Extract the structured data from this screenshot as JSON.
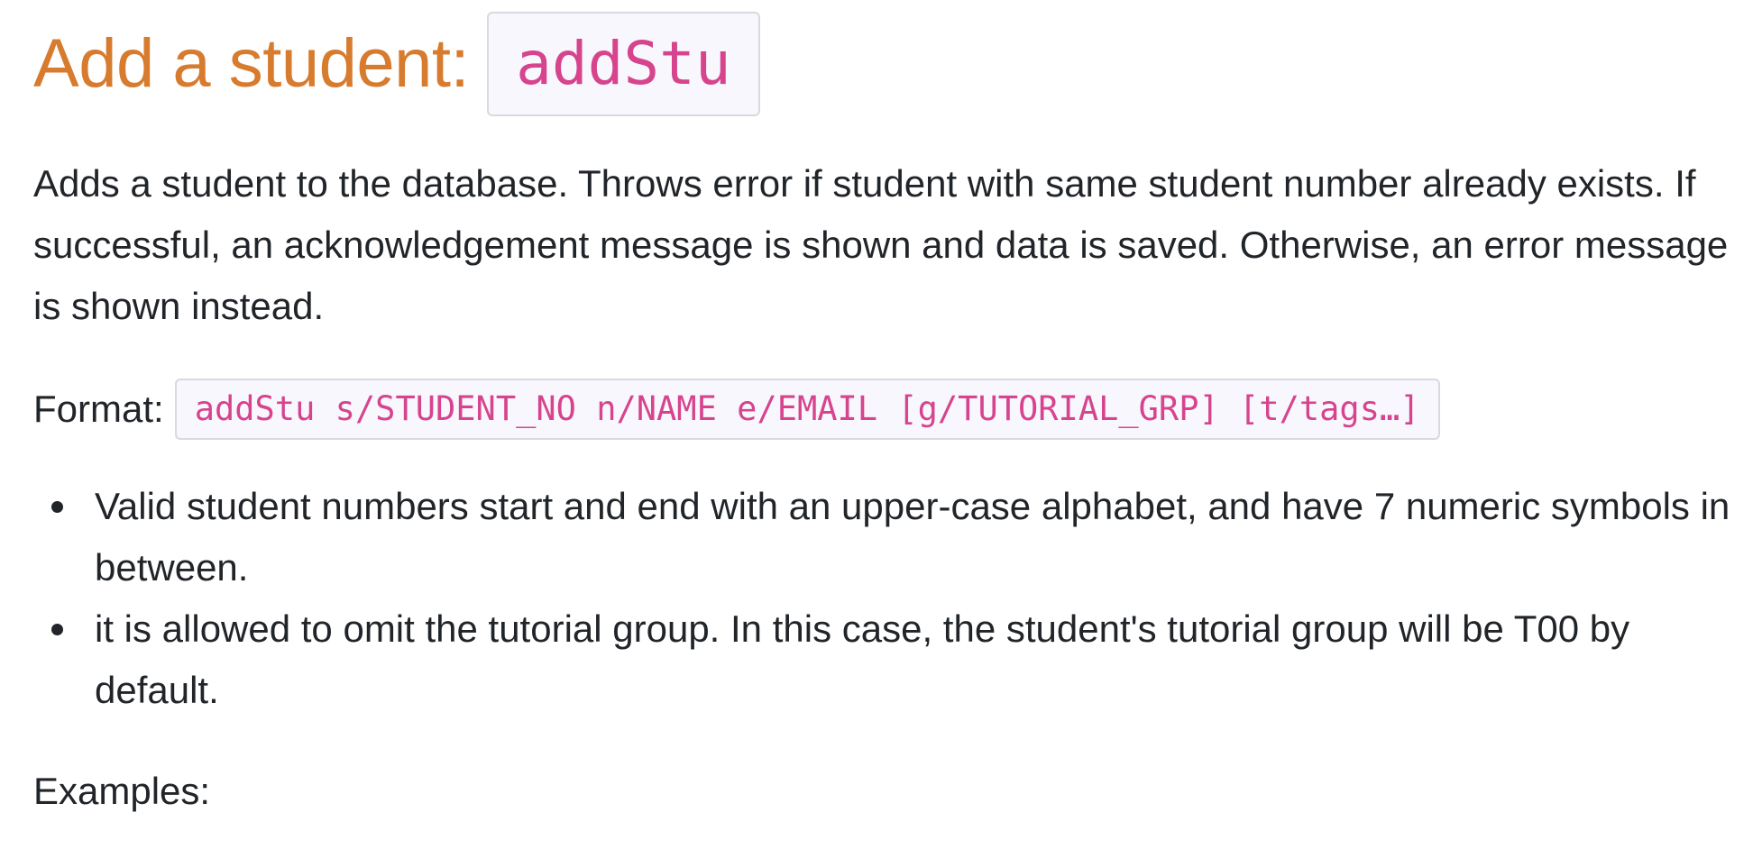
{
  "heading": {
    "text": "Add a student:",
    "command": "addStu"
  },
  "description": "Adds a student to the database. Throws error if student with same student number already exists. If successful, an acknowledgement message is shown and data is saved. Otherwise, an error message is shown instead.",
  "format": {
    "label": "Format:",
    "code": "addStu s/STUDENT_NO n/NAME e/EMAIL [g/TUTORIAL_GRP] [t/tags…]"
  },
  "notes": [
    "Valid student numbers start and end with an upper-case alphabet, and have 7 numeric symbols in between.",
    "it is allowed to omit the tutorial group. In this case, the student's tutorial group will be T00 by default."
  ],
  "examples_label": "Examples:",
  "colors": {
    "heading": "#d77b2f",
    "code_text": "#d6448e",
    "code_bg": "#f8f7fd",
    "body_text": "#212529"
  }
}
